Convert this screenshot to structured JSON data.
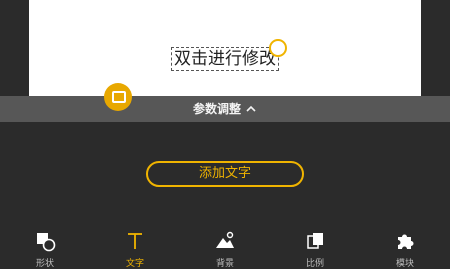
{
  "canvas": {
    "text": "双击进行修改"
  },
  "param_bar": {
    "label": "参数调整"
  },
  "actions": {
    "add_text": "添加文字"
  },
  "toolbar": {
    "items": [
      {
        "label": "形状",
        "icon": "shape-icon",
        "active": false
      },
      {
        "label": "文字",
        "icon": "text-icon",
        "active": true
      },
      {
        "label": "背景",
        "icon": "background-image-icon",
        "active": false
      },
      {
        "label": "比例",
        "icon": "ratio-icon",
        "active": false
      },
      {
        "label": "模块",
        "icon": "puzzle-icon",
        "active": false
      }
    ]
  },
  "colors": {
    "accent": "#f0b400",
    "background": "#2b2b2b",
    "canvas": "#ffffff",
    "param_bar": "#5a5a5a"
  }
}
